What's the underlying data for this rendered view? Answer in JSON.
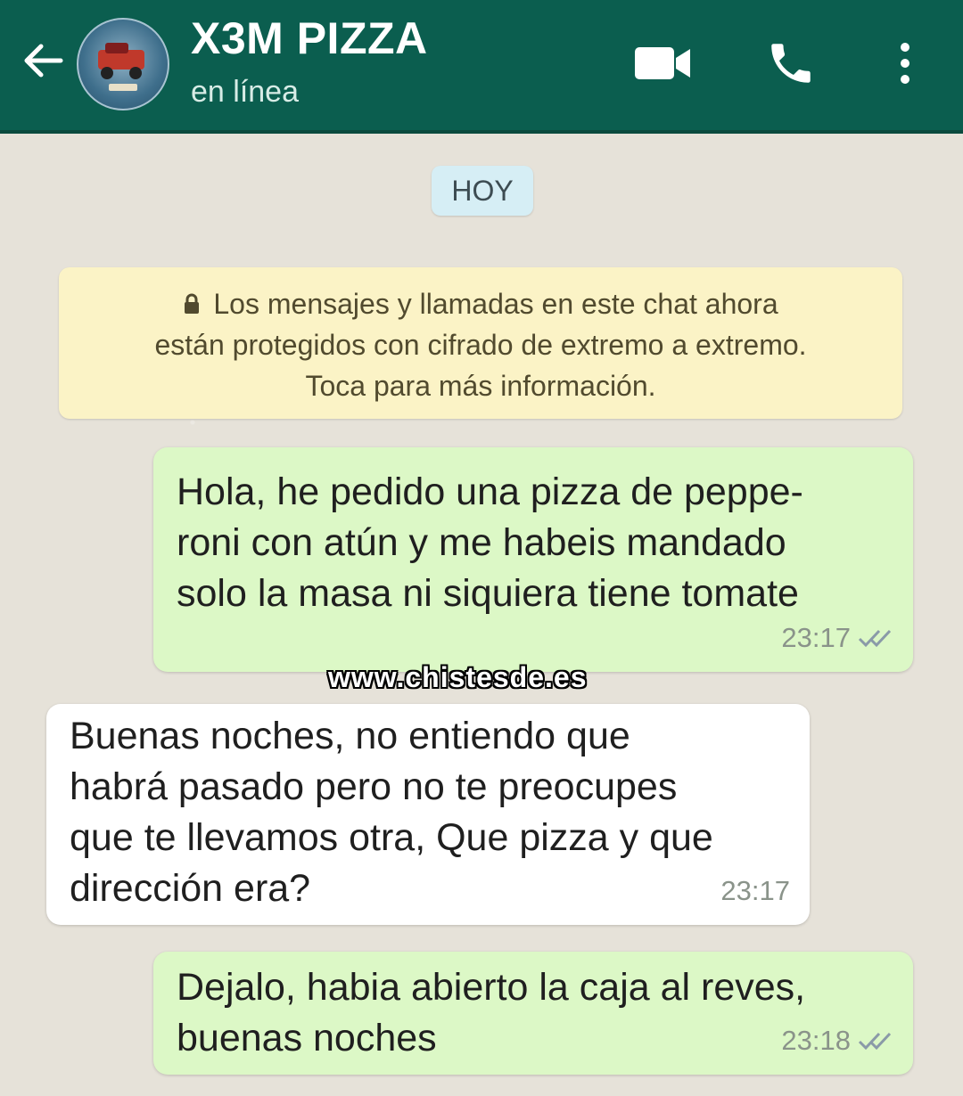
{
  "header": {
    "contact_name": "X3M PIZZA",
    "status": "en línea",
    "icons": {
      "back": "arrow-left-icon",
      "video": "video-camera-icon",
      "call": "phone-icon",
      "menu": "more-vertical-icon"
    },
    "colors": {
      "bar": "#0b5e4f"
    }
  },
  "chat": {
    "date_label": "HOY",
    "encryption_notice": {
      "line1": "Los mensajes y llamadas en este chat ahora",
      "line2": "están protegidos con cifrado de extremo a extremo.",
      "line3": "Toca para más información."
    },
    "messages": [
      {
        "direction": "outgoing",
        "text": "Hola, he pedido una pizza de peppe-\nroni con atún y me habeis mandado\nsolo la masa ni siquiera tiene tomate",
        "time": "23:17",
        "status": "read-double-check-icon"
      },
      {
        "direction": "incoming",
        "text": "Buenas noches, no entiendo que\nhabrá pasado pero no te preocupes\nque te llevamos otra, Que pizza y que\ndirección era?",
        "time": "23:17"
      },
      {
        "direction": "outgoing",
        "text": "Dejalo, habia abierto la caja al reves,\nbuenas noches",
        "time": "23:18",
        "status": "read-double-check-icon"
      }
    ],
    "colors": {
      "outgoing": "#dcf8c6",
      "incoming": "#ffffff",
      "background": "#e6e2d9"
    }
  },
  "watermark": "www.chistesde.es"
}
